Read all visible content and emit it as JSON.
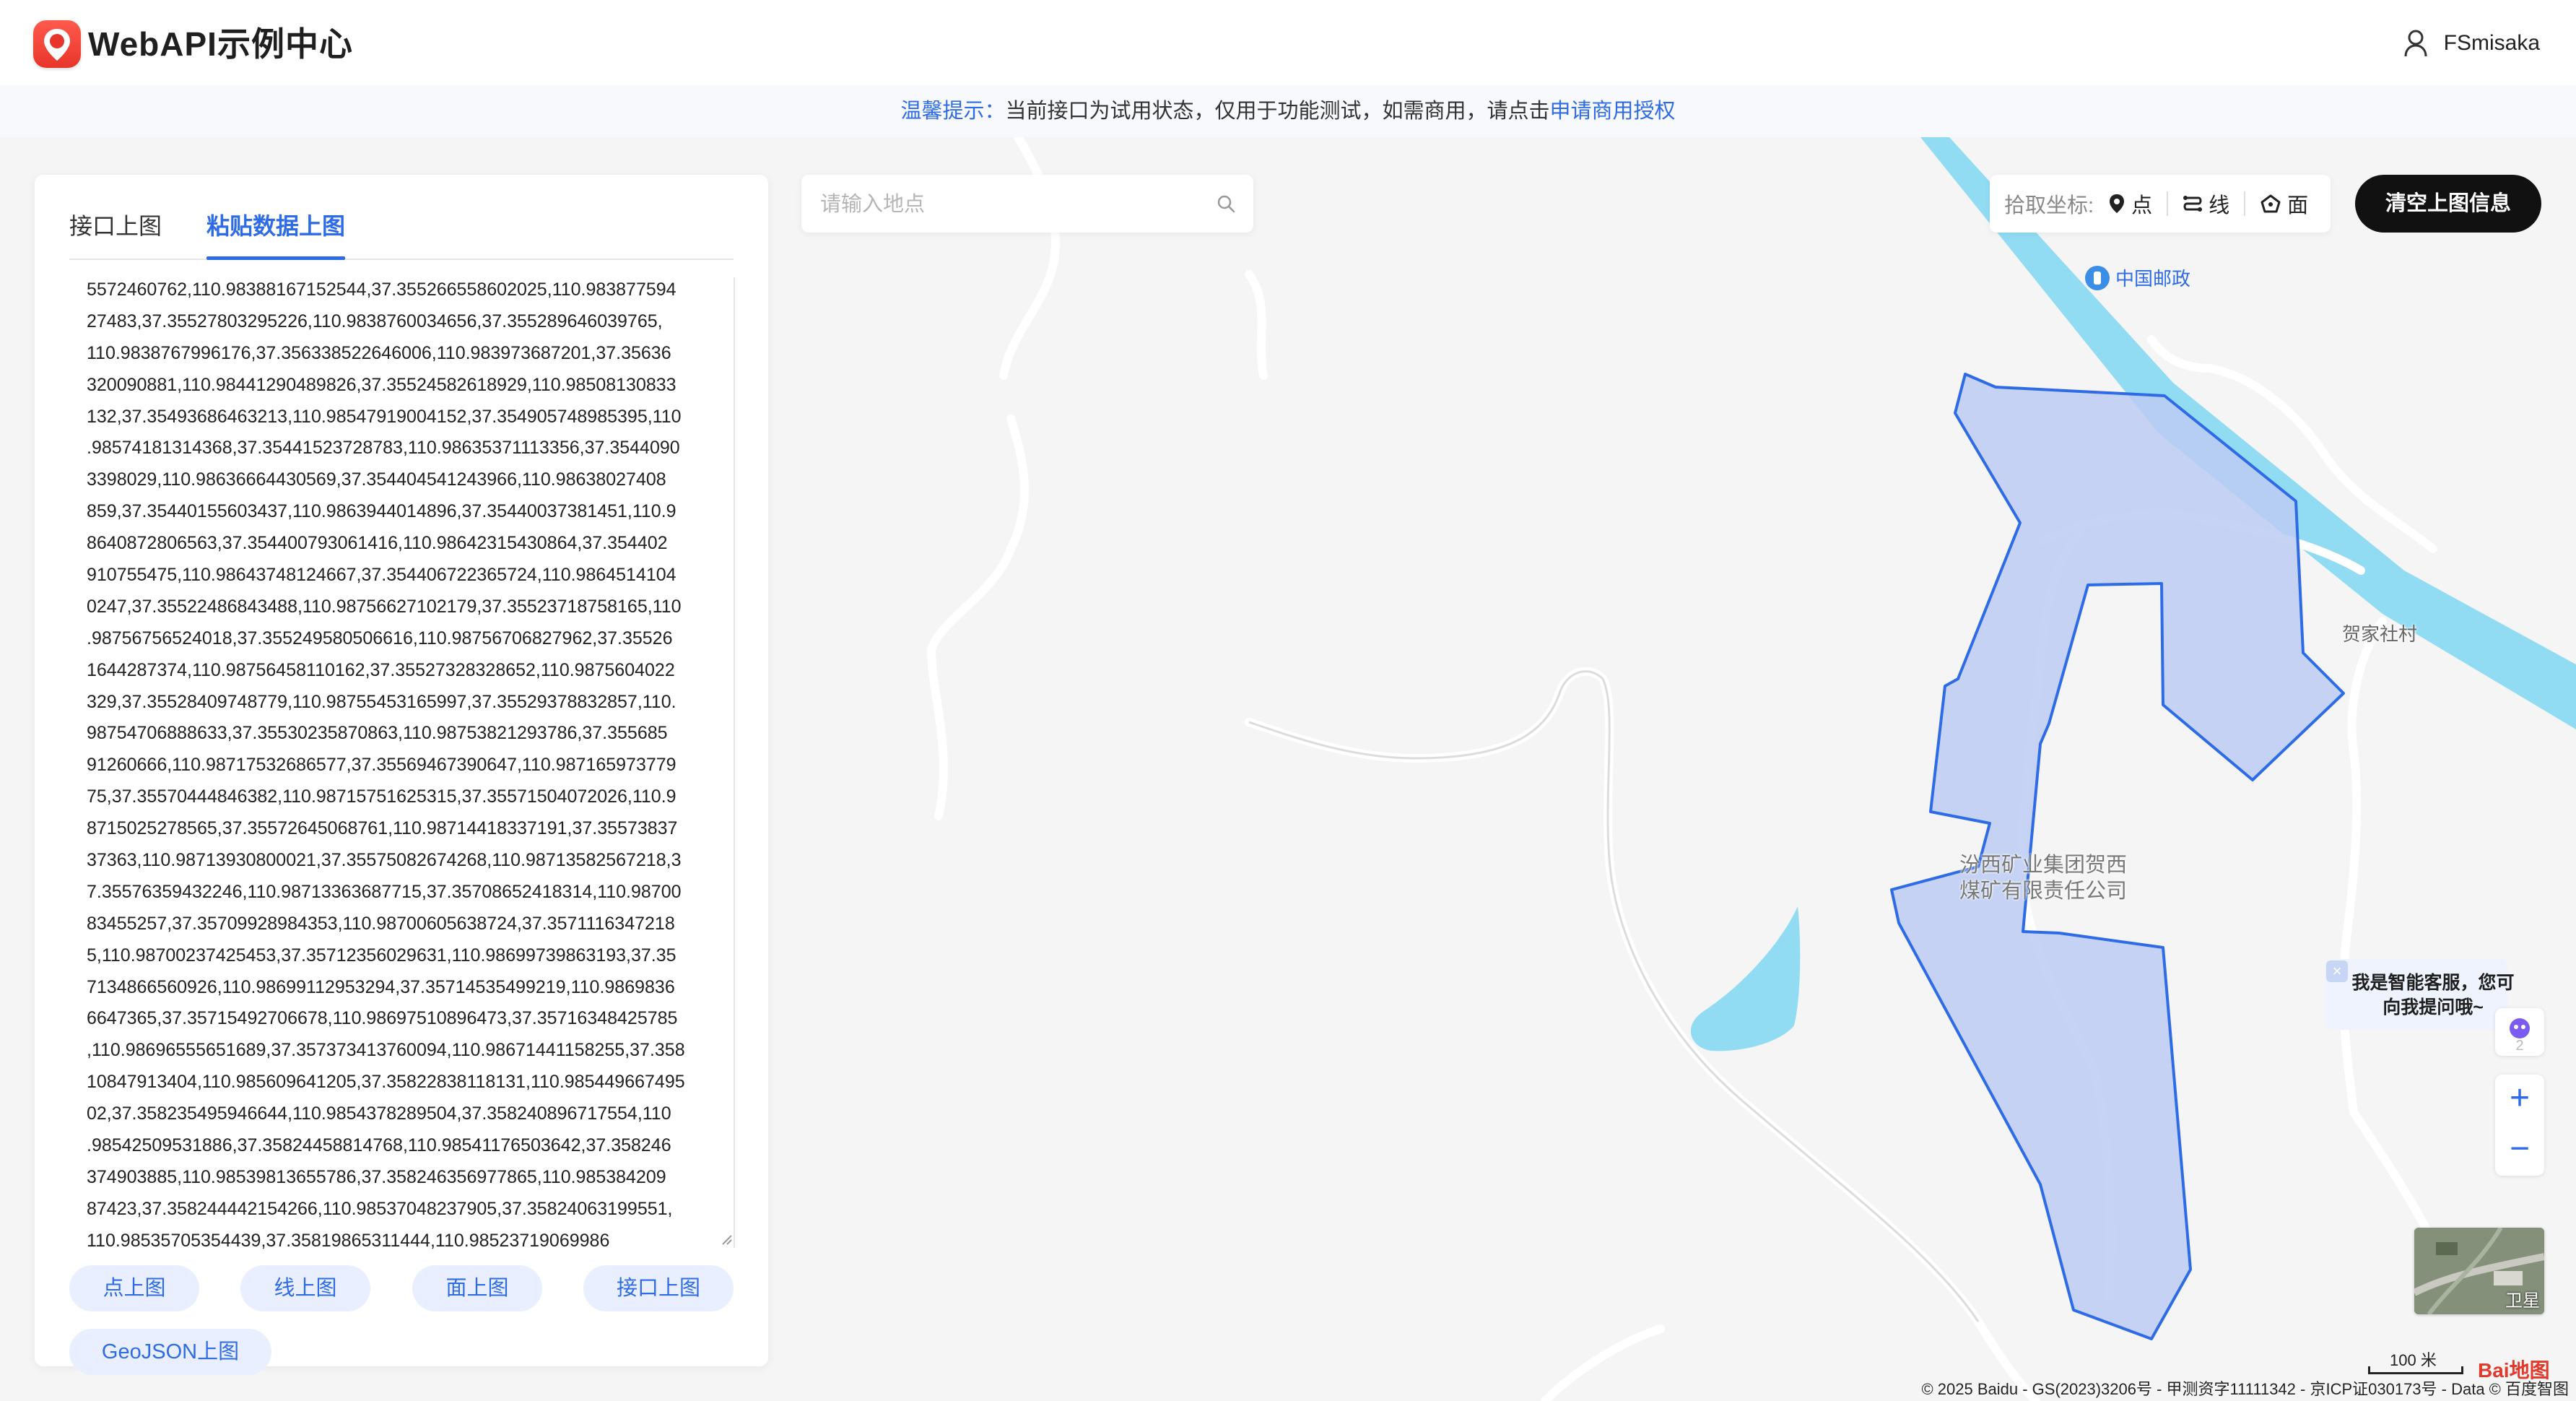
{
  "header": {
    "logo_text": "du",
    "title": "WebAPI示例中心",
    "username": "FSmisaka"
  },
  "notice": {
    "label": "温馨提示：",
    "text": "当前接口为试用状态，仅用于功能测试，如需商用，请点击",
    "link": "申请商用授权"
  },
  "panel": {
    "tabs": [
      "接口上图",
      "粘贴数据上图"
    ],
    "active_tab": "粘贴数据上图",
    "coord_lines": [
      "5572460762,110.98388167152544,37.355266558602025,110.983877594",
      "27483,37.35527803295226,110.9838760034656,37.355289646039765,",
      "110.9838767996176,37.356338522646006,110.983973687201,37.35636",
      "320090881,110.98441290489826,37.35524582618929,110.98508130833",
      "132,37.35493686463213,110.98547919004152,37.354905748985395,110",
      ".98574181314368,37.35441523728783,110.98635371113356,37.3544090",
      "3398029,110.98636664430569,37.354404541243966,110.98638027408",
      "859,37.35440155603437,110.9863944014896,37.35440037381451,110.9",
      "8640872806563,37.354400793061416,110.98642315430864,37.354402",
      "910755475,110.98643748124667,37.354406722365724,110.9864514104",
      "0247,37.35522486843488,110.98756627102179,37.35523718758165,110",
      ".98756756524018,37.355249580506616,110.98756706827962,37.35526",
      "1644287374,110.98756458110162,37.35527328328652,110.9875604022",
      "329,37.35528409748779,110.98755453165997,37.35529378832857,110.",
      "98754706888633,37.35530235870863,110.98753821293786,37.355685",
      "91260666,110.98717532686577,37.35569467390647,110.987165973779",
      "75,37.35570444846382,110.98715751625315,37.35571504072026,110.9",
      "8715025278565,37.35572645068761,110.98714418337191,37.35573837",
      "37363,110.98713930800021,37.35575082674268,110.98713582567218,3",
      "7.35576359432246,110.98713363687715,37.35708652418314,110.98700",
      "83455257,37.35709928984353,110.98700605638724,37.3571116347218",
      "5,110.98700237425453,37.35712356029631,110.98699739863193,37.35",
      "7134866560926,110.98699112953294,37.35714535499219,110.9869836",
      "6647365,37.35715492706678,110.98697510896473,37.35716348425785",
      ",110.98696555651689,37.357373413760094,110.98671441158255,37.358",
      "10847913404,110.985609641205,37.35822838118131,110.985449667495",
      "02,37.358235495946644,110.9854378289504,37.358240896717554,110",
      ".98542509531886,37.35824458814768,110.98541176503642,37.358246",
      "374903885,110.98539813655786,37.358246356977865,110.985384209",
      "87423,37.358244442154266,110.98537048237905,37.35824063199551,",
      "110.98535705354439,37.35819865311444,110.98523719069986"
    ],
    "buttons": [
      "点上图",
      "线上图",
      "面上图",
      "接口上图"
    ],
    "geojson_button": "GeoJSON上图"
  },
  "search": {
    "placeholder": "请输入地点"
  },
  "pick": {
    "label": "拾取坐标:",
    "point": "点",
    "line": "线",
    "polygon": "面"
  },
  "clear_button": "清空上图信息",
  "map": {
    "labels": {
      "postal": "中国邮政",
      "village": "贺家社村",
      "company": "汾西矿业集团贺西煤矿有限责任公司"
    },
    "polygon_fill": "#bccbf2",
    "polygon_stroke": "#2e6be6",
    "water": "#92dcf3",
    "road": "#ffffff"
  },
  "assistant": {
    "text": "我是智能客服，您可向我提问哦~"
  },
  "satellite_label": "卫星",
  "scale_text": "100 米",
  "baidu_logo": "Bai地图",
  "copyright": "© 2025 Baidu - GS(2023)3206号 - 甲测资字11111342 - 京ICP证030173号 - Data © 百度智图"
}
